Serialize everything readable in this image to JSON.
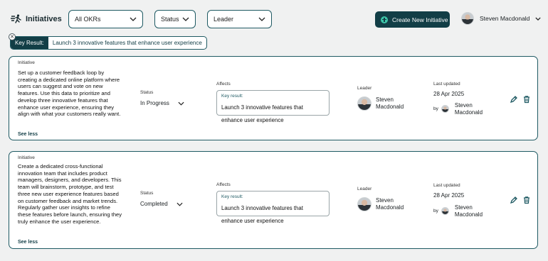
{
  "header": {
    "title": "Initiatives",
    "filters": {
      "okr": "All OKRs",
      "status": "Status",
      "leader": "Leader"
    },
    "create_button": "Create New Initiative",
    "user_name": "Steven Macdonald"
  },
  "active_filter": {
    "label": "Key Result:",
    "value": "Launch 3 innovative features that enhance user experience"
  },
  "labels": {
    "initiative": "Initiative",
    "status": "Status",
    "affects": "Affects",
    "leader": "Leader",
    "last_updated": "Last updated",
    "key_result": "Key result:",
    "by": "by",
    "see_less": "See less"
  },
  "initiatives": [
    {
      "description": "Set up a customer feedback loop by creating a dedicated online platform where users can suggest and vote on new features. Use this data to prioritize and develop three innovative features that enhance user experience, ensuring they align with what your customers really want.",
      "status": "In Progress",
      "key_result": "Launch 3 innovative features that enhance user experience",
      "leader_first": "Steven",
      "leader_last": "Macdonald",
      "updated_date": "28 Apr 2025",
      "updated_by_first": "Steven",
      "updated_by_last": "Macdonald"
    },
    {
      "description": "Create a dedicated cross-functional innovation team that includes product managers, designers, and developers. This team will brainstorm, prototype, and test three new user experience features based on customer feedback and market trends. Regularly gather user insights to refine these features before launch, ensuring they truly enhance the user experience.",
      "status": "Completed",
      "key_result": "Launch 3 innovative features that enhance user experience",
      "leader_first": "Steven",
      "leader_last": "Macdonald",
      "updated_date": "28 Apr 2025",
      "updated_by_first": "Steven",
      "updated_by_last": "Macdonald"
    }
  ],
  "colors": {
    "primary": "#123e46",
    "accent": "#3dc6a9",
    "border": "#1f5a63",
    "background": "#f0f1f1"
  }
}
